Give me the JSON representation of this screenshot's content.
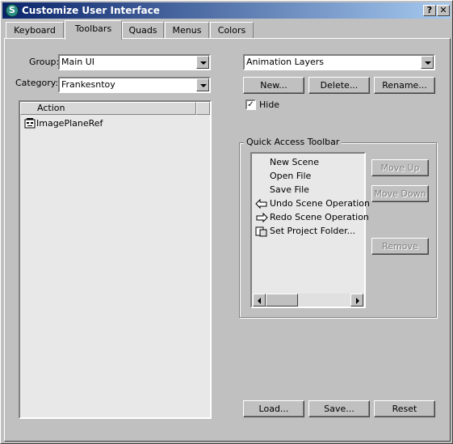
{
  "window": {
    "title": "Customize User Interface",
    "icon": "3dsmax-app-icon",
    "help_label": "?",
    "close_label": "✕"
  },
  "tabs": [
    {
      "label": "Keyboard",
      "active": false
    },
    {
      "label": "Toolbars",
      "active": true
    },
    {
      "label": "Quads",
      "active": false
    },
    {
      "label": "Menus",
      "active": false
    },
    {
      "label": "Colors",
      "active": false
    }
  ],
  "left": {
    "group_label": "Group:",
    "group_value": "Main UI",
    "category_label": "Category:",
    "category_value": "Frankesntoy",
    "list_header": "Action",
    "actions": [
      {
        "icon": "robot-face-icon",
        "label": "ImagePlaneRef"
      }
    ]
  },
  "right": {
    "toolbar_select_value": "Animation Layers",
    "new_label": "New...",
    "delete_label": "Delete...",
    "rename_label": "Rename...",
    "hide_label": "Hide",
    "hide_checked": true,
    "quick_access": {
      "title": "Quick Access Toolbar",
      "items": [
        {
          "icon": "",
          "label": "New Scene"
        },
        {
          "icon": "",
          "label": "Open File"
        },
        {
          "icon": "",
          "label": "Save File"
        },
        {
          "icon": "undo-icon",
          "label": "Undo Scene Operation"
        },
        {
          "icon": "redo-icon",
          "label": "Redo Scene Operation"
        },
        {
          "icon": "project-folder-icon",
          "label": "Set Project Folder..."
        }
      ],
      "move_up_label": "Move Up",
      "move_down_label": "Move Down",
      "remove_label": "Remove"
    }
  },
  "footer": {
    "load_label": "Load...",
    "save_label": "Save...",
    "reset_label": "Reset"
  }
}
